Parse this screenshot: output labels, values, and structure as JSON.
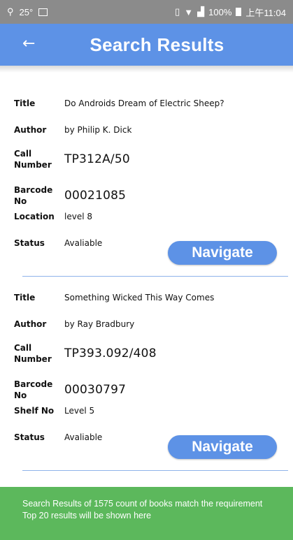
{
  "status_bar": {
    "temperature": "25°",
    "battery": "100%",
    "time": "上午11:04"
  },
  "app_bar": {
    "title": "Search Results",
    "back_icon": "←"
  },
  "books": [
    {
      "title_label": "Title",
      "title": "Do Androids Dream of Electric Sheep?",
      "author_label": "Author",
      "author": "by Philip K. Dick",
      "call_label_1": "Call",
      "call_label_2": "Number",
      "call_number": "TP312A/50",
      "barcode_label": "Barcode No",
      "barcode": "00021085",
      "location_label": "Location",
      "location": "level 8",
      "status_label": "Status",
      "status": "Avaliable",
      "button_label": "Navigate"
    },
    {
      "title_label": "Title",
      "title": "Something Wicked This Way Comes",
      "author_label": "Author",
      "author": "by Ray Bradbury",
      "call_label_1": "Call",
      "call_label_2": "Number",
      "call_number": "TP393.092/408",
      "barcode_label": "Barcode No",
      "barcode": "00030797",
      "location_label": "Shelf No",
      "location": "Level 5",
      "status_label": "Status",
      "status": "Avaliable",
      "button_label": "Navigate"
    }
  ],
  "banner": {
    "line1": "Search Results of 1575 count of books match the requirement",
    "line2": "Top 20 results will be shown here"
  },
  "colors": {
    "accent": "#5d92e6",
    "banner": "#5cb85c",
    "status_bar": "#8b8b8b"
  }
}
